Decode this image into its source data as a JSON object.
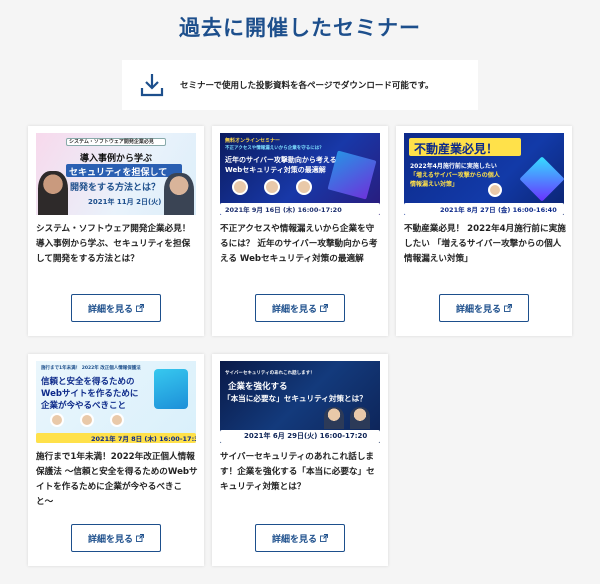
{
  "page": {
    "title": "過去に開催したセミナー",
    "download_text": "セミナーで使用した投影資料を各ページでダウンロード可能です。"
  },
  "colors": {
    "brand": "#1d4f8c",
    "accent_cyan": "#22b5e0",
    "accent_yellow": "#ffe14a"
  },
  "seminars": [
    {
      "title": "システム・ソフトウェア開発企業必見！導入事例から学ぶ、セキュリティを担保して開発をする方法とは？",
      "button": "詳細を見る",
      "thumb": {
        "tag": "システム・ソフトウェア開発企業必見",
        "line1": "導入事例から学ぶ",
        "line2": "セキュリティを担保して",
        "line3": "開発をする方法とは？",
        "date": "2021年 11月 2日(火)"
      }
    },
    {
      "title": "不正アクセスや情報漏えいから企業を守るには？ 近年のサイバー攻撃動向から考える Webセキュリティ対策の最適解",
      "button": "詳細を見る",
      "thumb": {
        "tag": "無料オンラインセミナー",
        "sub": "不正アクセスや情報漏えいから企業を守るには？",
        "line1": "近年のサイバー攻撃動向から考える",
        "line2": "Webセキュリティ対策の最適解",
        "date": "2021年 9月 16日 (木) 16:00-17:20"
      }
    },
    {
      "title": "不動産業必見！ 2022年4月施行前に実施したい 「増えるサイバー攻撃からの個人情報漏えい対策」",
      "button": "詳細を見る",
      "thumb": {
        "line1": "不動産業必見！",
        "line2": "2022年4月施行前に実施したい",
        "line3": "「増えるサイバー攻撃からの個人",
        "line4": "情報漏えい対策」",
        "date": "2021年 8月 27日 (金) 16:00-16:40"
      }
    },
    {
      "title": "施行まで1年未満！2022年改正個人情報保護法 〜信頼と安全を得るためのWebサイトを作るために企業が今やるべきこと〜",
      "button": "詳細を見る",
      "thumb": {
        "tag": "施行まで1年未満！ 2022年 改正個人情報保護法",
        "line1": "信頼と安全を得るための",
        "line2": "Webサイトを作るために",
        "line3": "企業が今やるべきこと",
        "date": "2021年 7月 8日 (木) 16:00-17:30"
      }
    },
    {
      "title": "サイバーセキュリティのあれこれ話します！企業を強化する「本当に必要な」セキュリティ対策とは？",
      "button": "詳細を見る",
      "thumb": {
        "tag": "サイバーセキュリティのあれこれ話します！",
        "line1": "企業を強化する",
        "line2": "「本当に必要な」セキュリティ対策とは？",
        "date": "2021年 6月 29日(火) 16:00-17:20"
      }
    }
  ]
}
